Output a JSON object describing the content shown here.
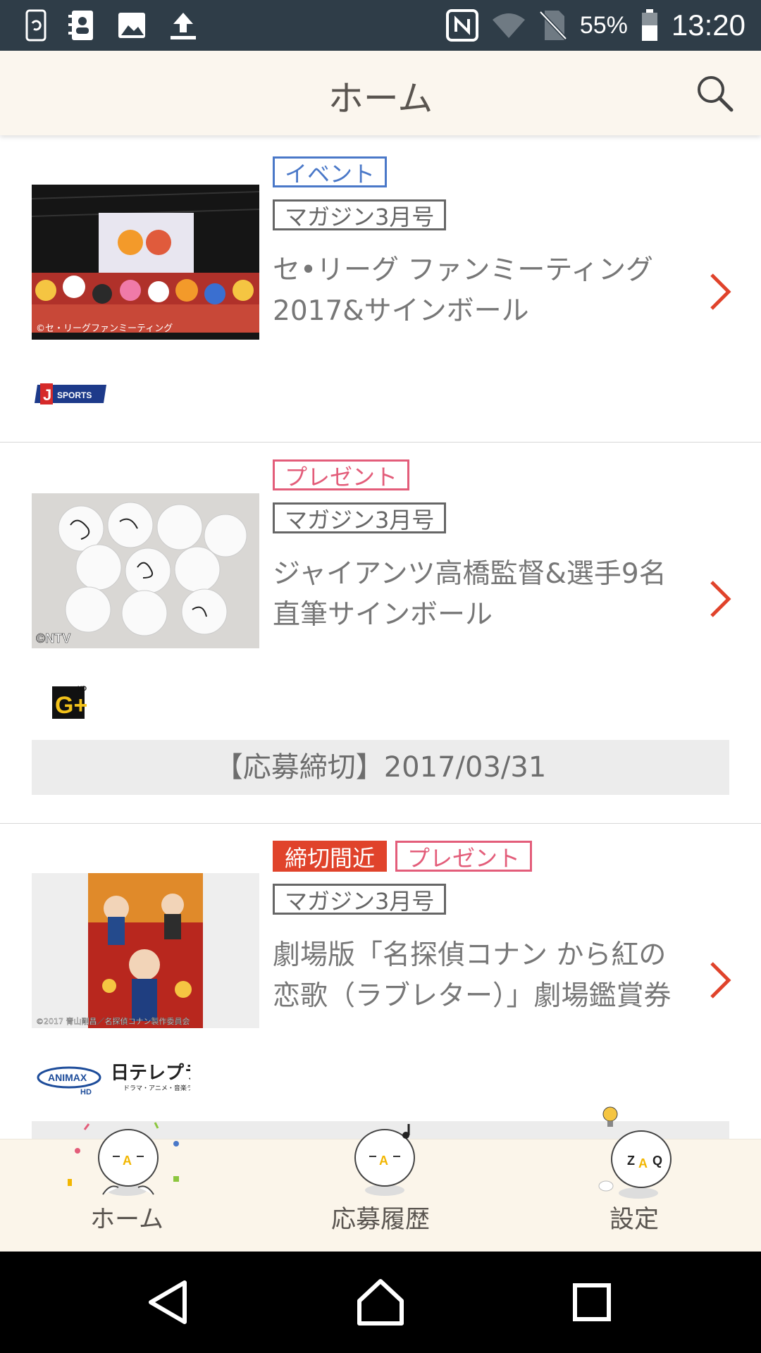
{
  "status_bar": {
    "battery": "55%",
    "time": "13:20",
    "icons_left": [
      "sync-icon",
      "contacts-icon",
      "image-icon",
      "upload-icon"
    ],
    "icons_right": [
      "nfc-icon",
      "wifi-icon",
      "no-sim-icon",
      "battery-icon"
    ]
  },
  "header": {
    "title": "ホーム",
    "search_icon": "search-icon"
  },
  "cards": [
    {
      "tags": [
        {
          "label": "イベント",
          "style": "event"
        }
      ],
      "magazine": "マガジン3月号",
      "title": "セ•リーグ ファンミーティング 2017&サインボール",
      "thumb_caption": "©セ・リーグファンミーティング",
      "channel_logos": [
        "J SPORTS"
      ],
      "deadline": ""
    },
    {
      "tags": [
        {
          "label": "プレゼント",
          "style": "present"
        }
      ],
      "magazine": "マガジン3月号",
      "title": "ジャイアンツ高橋監督&選手9名 直筆サインボール",
      "thumb_caption": "©NTV",
      "channel_logos": [
        "G+"
      ],
      "deadline": "【応募締切】2017/03/31"
    },
    {
      "tags": [
        {
          "label": "締切間近",
          "style": "urgent"
        },
        {
          "label": "プレゼント",
          "style": "present"
        }
      ],
      "magazine": "マガジン3月号",
      "title": "劇場版「名探偵コナン から紅の 恋歌（ラブレター）」劇場鑑賞券",
      "thumb_caption": "©2017 青山剛昌／名探偵コナン製作委員会",
      "channel_logos": [
        "ANIMAX",
        "日テレプラス"
      ],
      "deadline": ""
    }
  ],
  "logo_text": {
    "jsports": "SPORTS",
    "gplus": "G+",
    "animax": "ANIMAX",
    "nittele": "日テレプラス",
    "nittele_sub": "ドラマ・アニメ・音楽ライブ"
  },
  "tabbar": {
    "items": [
      {
        "label": "ホーム",
        "icon": "mascot-home-icon"
      },
      {
        "label": "応募履歴",
        "icon": "mascot-history-icon"
      },
      {
        "label": "設定",
        "icon": "mascot-settings-icon"
      }
    ]
  },
  "navbar": {
    "buttons": [
      "back-icon",
      "home-icon",
      "recents-icon"
    ]
  },
  "colors": {
    "status_bar": "#2f3d48",
    "header_bg": "#fbf6ee",
    "event_tag": "#4a78c8",
    "present_tag": "#e35d7a",
    "urgent_tag": "#e0432b",
    "chevron": "#e0432b"
  }
}
